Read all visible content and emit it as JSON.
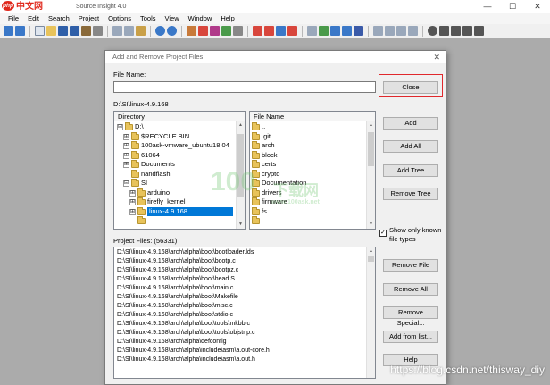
{
  "app": {
    "logo_text": "中文网",
    "logo_badge": "php",
    "title": "Source Insight 4.0",
    "window_controls": [
      "—",
      "☐",
      "✕"
    ]
  },
  "menu": [
    "File",
    "Edit",
    "Search",
    "Project",
    "Options",
    "Tools",
    "View",
    "Window",
    "Help"
  ],
  "dialog": {
    "title": "Add and Remove Project Files",
    "close_glyph": "✕",
    "file_name_label": "File Name:",
    "file_name_value": "",
    "current_path": "D:\\SI\\linux-4.9.168",
    "directory_header": "Directory",
    "file_name_header": "File Name",
    "directory_tree": [
      {
        "label": "D:\\",
        "expander": "⊟",
        "level": 0
      },
      {
        "label": "$RECYCLE.BIN",
        "expander": "⊞",
        "level": 1
      },
      {
        "label": "100ask-vmware_ubuntu18.04",
        "expander": "⊞",
        "level": 1
      },
      {
        "label": "61064",
        "expander": "⊞",
        "level": 1
      },
      {
        "label": "Documents",
        "expander": "⊞",
        "level": 1
      },
      {
        "label": "nandflash",
        "expander": "",
        "level": 1
      },
      {
        "label": "SI",
        "expander": "⊟",
        "level": 1
      },
      {
        "label": "arduino",
        "expander": "⊞",
        "level": 2
      },
      {
        "label": "firefly_kernel",
        "expander": "⊞",
        "level": 2
      },
      {
        "label": "linux-4.9.168",
        "expander": "⊞",
        "level": 2,
        "selected": true
      }
    ],
    "file_list": [
      "..",
      ".git",
      "arch",
      "block",
      "certs",
      "crypto",
      "Documentation",
      "drivers",
      "firmware",
      "fs"
    ],
    "buttons_top": {
      "close": "Close",
      "add": "Add",
      "add_all": "Add All",
      "add_tree": "Add Tree",
      "remove_tree": "Remove Tree"
    },
    "show_only_known": "Show only known\nfile types",
    "show_only_known_checked": true,
    "project_files_label": "Project Files: (56331)",
    "project_files": [
      "D:\\SI\\linux-4.9.168\\arch\\alpha\\boot\\bootloader.lds",
      "D:\\SI\\linux-4.9.168\\arch\\alpha\\boot\\bootp.c",
      "D:\\SI\\linux-4.9.168\\arch\\alpha\\boot\\bootpz.c",
      "D:\\SI\\linux-4.9.168\\arch\\alpha\\boot\\head.S",
      "D:\\SI\\linux-4.9.168\\arch\\alpha\\boot\\main.c",
      "D:\\SI\\linux-4.9.168\\arch\\alpha\\boot\\Makefile",
      "D:\\SI\\linux-4.9.168\\arch\\alpha\\boot\\misc.c",
      "D:\\SI\\linux-4.9.168\\arch\\alpha\\boot\\stdio.c",
      "D:\\SI\\linux-4.9.168\\arch\\alpha\\boot\\tools\\mkbb.c",
      "D:\\SI\\linux-4.9.168\\arch\\alpha\\boot\\tools\\objstrip.c",
      "D:\\SI\\linux-4.9.168\\arch\\alpha\\defconfig",
      "D:\\SI\\linux-4.9.168\\arch\\alpha\\include\\asm\\a.out-core.h",
      "D:\\SI\\linux-4.9.168\\arch\\alpha\\include\\asm\\a.out.h"
    ],
    "buttons_bottom": {
      "remove_file": "Remove File",
      "remove_all": "Remove All",
      "remove_special": "Remove Special...",
      "add_from_list": "Add from list...",
      "help": "Help"
    }
  },
  "watermarks": {
    "center_brand": "100",
    "center_cn": "下载网",
    "center_url": "www.100ask.net",
    "csdn": "https://blog.csdn.net/thisway_diy"
  },
  "colors": {
    "selection": "#0078d7",
    "highlight_border": "#e0282c",
    "folder": "#e8c35b",
    "desktop": "#ababab"
  }
}
